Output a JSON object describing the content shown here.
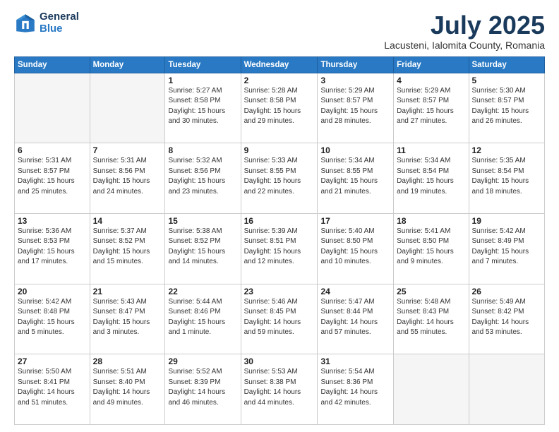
{
  "header": {
    "logo_general": "General",
    "logo_blue": "Blue",
    "month_title": "July 2025",
    "subtitle": "Lacusteni, Ialomita County, Romania"
  },
  "weekdays": [
    "Sunday",
    "Monday",
    "Tuesday",
    "Wednesday",
    "Thursday",
    "Friday",
    "Saturday"
  ],
  "weeks": [
    [
      {
        "day": "",
        "info": ""
      },
      {
        "day": "",
        "info": ""
      },
      {
        "day": "1",
        "info": "Sunrise: 5:27 AM\nSunset: 8:58 PM\nDaylight: 15 hours\nand 30 minutes."
      },
      {
        "day": "2",
        "info": "Sunrise: 5:28 AM\nSunset: 8:58 PM\nDaylight: 15 hours\nand 29 minutes."
      },
      {
        "day": "3",
        "info": "Sunrise: 5:29 AM\nSunset: 8:57 PM\nDaylight: 15 hours\nand 28 minutes."
      },
      {
        "day": "4",
        "info": "Sunrise: 5:29 AM\nSunset: 8:57 PM\nDaylight: 15 hours\nand 27 minutes."
      },
      {
        "day": "5",
        "info": "Sunrise: 5:30 AM\nSunset: 8:57 PM\nDaylight: 15 hours\nand 26 minutes."
      }
    ],
    [
      {
        "day": "6",
        "info": "Sunrise: 5:31 AM\nSunset: 8:57 PM\nDaylight: 15 hours\nand 25 minutes."
      },
      {
        "day": "7",
        "info": "Sunrise: 5:31 AM\nSunset: 8:56 PM\nDaylight: 15 hours\nand 24 minutes."
      },
      {
        "day": "8",
        "info": "Sunrise: 5:32 AM\nSunset: 8:56 PM\nDaylight: 15 hours\nand 23 minutes."
      },
      {
        "day": "9",
        "info": "Sunrise: 5:33 AM\nSunset: 8:55 PM\nDaylight: 15 hours\nand 22 minutes."
      },
      {
        "day": "10",
        "info": "Sunrise: 5:34 AM\nSunset: 8:55 PM\nDaylight: 15 hours\nand 21 minutes."
      },
      {
        "day": "11",
        "info": "Sunrise: 5:34 AM\nSunset: 8:54 PM\nDaylight: 15 hours\nand 19 minutes."
      },
      {
        "day": "12",
        "info": "Sunrise: 5:35 AM\nSunset: 8:54 PM\nDaylight: 15 hours\nand 18 minutes."
      }
    ],
    [
      {
        "day": "13",
        "info": "Sunrise: 5:36 AM\nSunset: 8:53 PM\nDaylight: 15 hours\nand 17 minutes."
      },
      {
        "day": "14",
        "info": "Sunrise: 5:37 AM\nSunset: 8:52 PM\nDaylight: 15 hours\nand 15 minutes."
      },
      {
        "day": "15",
        "info": "Sunrise: 5:38 AM\nSunset: 8:52 PM\nDaylight: 15 hours\nand 14 minutes."
      },
      {
        "day": "16",
        "info": "Sunrise: 5:39 AM\nSunset: 8:51 PM\nDaylight: 15 hours\nand 12 minutes."
      },
      {
        "day": "17",
        "info": "Sunrise: 5:40 AM\nSunset: 8:50 PM\nDaylight: 15 hours\nand 10 minutes."
      },
      {
        "day": "18",
        "info": "Sunrise: 5:41 AM\nSunset: 8:50 PM\nDaylight: 15 hours\nand 9 minutes."
      },
      {
        "day": "19",
        "info": "Sunrise: 5:42 AM\nSunset: 8:49 PM\nDaylight: 15 hours\nand 7 minutes."
      }
    ],
    [
      {
        "day": "20",
        "info": "Sunrise: 5:42 AM\nSunset: 8:48 PM\nDaylight: 15 hours\nand 5 minutes."
      },
      {
        "day": "21",
        "info": "Sunrise: 5:43 AM\nSunset: 8:47 PM\nDaylight: 15 hours\nand 3 minutes."
      },
      {
        "day": "22",
        "info": "Sunrise: 5:44 AM\nSunset: 8:46 PM\nDaylight: 15 hours\nand 1 minute."
      },
      {
        "day": "23",
        "info": "Sunrise: 5:46 AM\nSunset: 8:45 PM\nDaylight: 14 hours\nand 59 minutes."
      },
      {
        "day": "24",
        "info": "Sunrise: 5:47 AM\nSunset: 8:44 PM\nDaylight: 14 hours\nand 57 minutes."
      },
      {
        "day": "25",
        "info": "Sunrise: 5:48 AM\nSunset: 8:43 PM\nDaylight: 14 hours\nand 55 minutes."
      },
      {
        "day": "26",
        "info": "Sunrise: 5:49 AM\nSunset: 8:42 PM\nDaylight: 14 hours\nand 53 minutes."
      }
    ],
    [
      {
        "day": "27",
        "info": "Sunrise: 5:50 AM\nSunset: 8:41 PM\nDaylight: 14 hours\nand 51 minutes."
      },
      {
        "day": "28",
        "info": "Sunrise: 5:51 AM\nSunset: 8:40 PM\nDaylight: 14 hours\nand 49 minutes."
      },
      {
        "day": "29",
        "info": "Sunrise: 5:52 AM\nSunset: 8:39 PM\nDaylight: 14 hours\nand 46 minutes."
      },
      {
        "day": "30",
        "info": "Sunrise: 5:53 AM\nSunset: 8:38 PM\nDaylight: 14 hours\nand 44 minutes."
      },
      {
        "day": "31",
        "info": "Sunrise: 5:54 AM\nSunset: 8:36 PM\nDaylight: 14 hours\nand 42 minutes."
      },
      {
        "day": "",
        "info": ""
      },
      {
        "day": "",
        "info": ""
      }
    ]
  ]
}
